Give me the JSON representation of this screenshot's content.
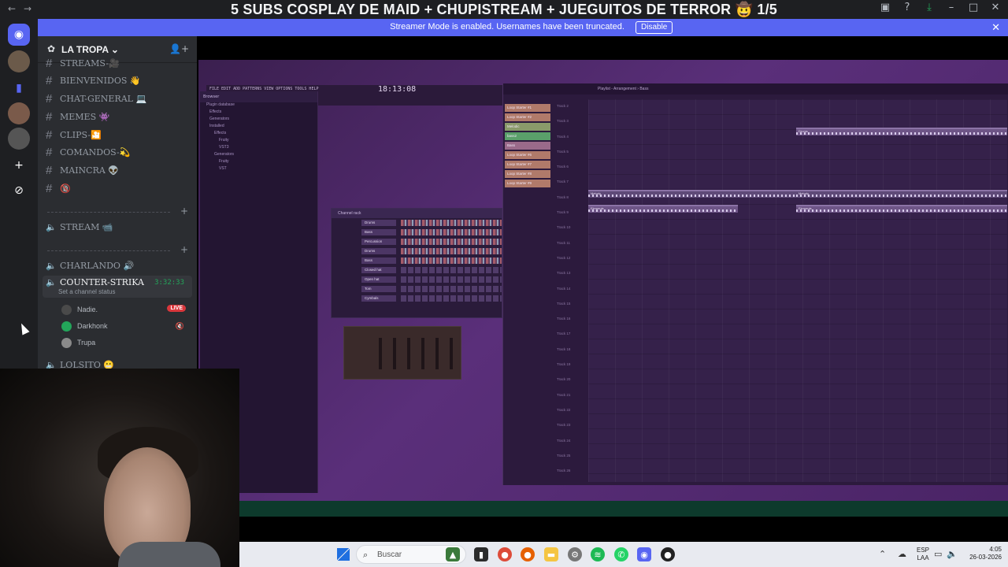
{
  "window": {
    "title": "5 SUBS COSPLAY DE MAID + CHUPISTREAM + JUEGUITOS DE TERROR 🤠 1/5",
    "back_icon": "←",
    "forward_icon": "→"
  },
  "banner": {
    "message": "Streamer Mode is enabled. Usernames have been truncated.",
    "disable_label": "Disable",
    "close_icon": "✕"
  },
  "server": {
    "name": "LA TROPA",
    "chevron": "⌄"
  },
  "channels": [
    {
      "type": "text",
      "name": "STREAMS-🎥"
    },
    {
      "type": "text",
      "name": "BIENVENIDOS 👋"
    },
    {
      "type": "text",
      "name": "CHAT-GENERAL 💻"
    },
    {
      "type": "text",
      "name": "MEMES 👾"
    },
    {
      "type": "text",
      "name": "CLIPS-🎦"
    },
    {
      "type": "text",
      "name": "COMANDOS-💫"
    },
    {
      "type": "text",
      "name": "MAINCRA 👽"
    },
    {
      "type": "text",
      "name": "🔞"
    }
  ],
  "voice_stream": {
    "name": "STREAM 📹"
  },
  "voice_channels": [
    {
      "name": "CHARLANDO 🔊"
    },
    {
      "name": "COUNTER-STRIKA",
      "timer": "3:32:33",
      "status": "Set a channel status"
    },
    {
      "name": "LOLSITO 😬"
    }
  ],
  "voice_users": [
    {
      "name": "Nadie.",
      "badge": "LIVE"
    },
    {
      "name": "Darkhonk"
    },
    {
      "name": "Trupa"
    }
  ],
  "fl": {
    "time": "18:13:08",
    "playlist_title": "Playlist - Arrangement › Bass",
    "rack_title": "Channel rack",
    "rack_rows": [
      "Drums",
      "Bass",
      "Percussion",
      "Drums",
      "Bass",
      "Closed hat",
      "Open hat",
      "Tom",
      "Cymbals"
    ],
    "patterns": [
      "Loop Starter #1",
      "Loop Starter #2",
      "Melodic",
      "bass2",
      "Bass",
      "Loop Starter #6",
      "Loop Starter #7",
      "Loop Starter #8",
      "Loop Starter #9"
    ],
    "tracks": [
      "Track 2",
      "Track 3",
      "Track 4",
      "Track 5",
      "Track 6",
      "Track 7",
      "Track 8",
      "Track 9",
      "Track 10",
      "Track 11",
      "Track 12",
      "Track 13",
      "Track 14",
      "Track 15",
      "Track 16",
      "Track 17",
      "Track 18",
      "Track 19",
      "Track 20",
      "Track 21",
      "Track 22",
      "Track 23",
      "Track 24",
      "Track 25",
      "Track 26"
    ],
    "browser_rows": [
      "Plugin database",
      "Effects",
      "Generators",
      "Installed",
      "Effects",
      "Fruity",
      "VST3",
      "Generators",
      "Fruity",
      "VST"
    ]
  },
  "taskbar": {
    "search_placeholder": "Buscar",
    "lang_top": "ESP",
    "lang_bottom": "LAA",
    "time": "4:05",
    "date": "26-03-2026"
  },
  "colors": {
    "accent": "#5865f2",
    "live": "#da373c",
    "voice_green": "#23a55a"
  }
}
